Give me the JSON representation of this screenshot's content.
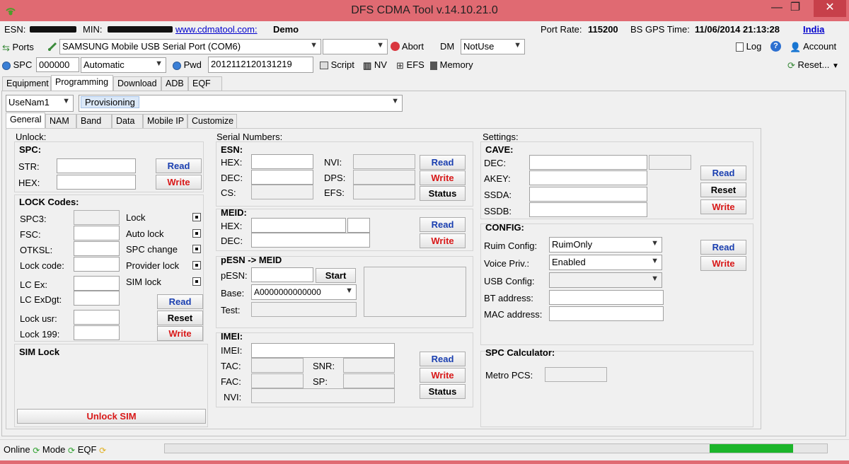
{
  "window": {
    "title": "DFS CDMA Tool v.14.10.21.0",
    "min": "—",
    "max": "❐",
    "close": "✕"
  },
  "info": {
    "esn_label": "ESN:",
    "min_label": "MIN:",
    "site": "www.cdmatool.com:",
    "mode": "Demo",
    "port_rate_label": "Port Rate:",
    "port_rate": "115200",
    "gps_label": "BS GPS Time:",
    "gps_time": "11/06/2014 21:13:28",
    "country": "India"
  },
  "toolbar1": {
    "ports": "Ports",
    "port_value": "SAMSUNG Mobile USB Serial Port  (COM6)",
    "abort": "Abort",
    "dm": "DM",
    "dm_value": "NotUse",
    "log": "Log",
    "account": "Account"
  },
  "toolbar2": {
    "spc": "SPC",
    "spc_value": "000000",
    "mode_value": "Automatic",
    "pwd": "Pwd",
    "pwd_value": "2012112120131219",
    "script": "Script",
    "nv": "NV",
    "efs": "EFS",
    "memory": "Memory",
    "reset": "Reset..."
  },
  "main_tabs": [
    "Equipment",
    "Programming",
    "Download",
    "ADB",
    "EQF"
  ],
  "user_combo": "UseNam1",
  "provisioning": "Provisioning",
  "sub_tabs": [
    "General",
    "NAM",
    "Band",
    "Data",
    "Mobile IP",
    "Customize"
  ],
  "unlock": {
    "title": "Unlock:",
    "spc_title": "SPC:",
    "str": "STR:",
    "hex": "HEX:",
    "read": "Read",
    "write": "Write",
    "lock_title": "LOCK Codes:",
    "spc3": "SPC3:",
    "fsc": "FSC:",
    "otksl": "OTKSL:",
    "lock_code": "Lock code:",
    "lc_ex": "LC Ex:",
    "lc_exdgt": "LC ExDgt:",
    "lock_usr": "Lock usr:",
    "lock_199": "Lock 199:",
    "lock": "Lock",
    "auto_lock": "Auto lock",
    "spc_change": "SPC change",
    "provider_lock": "Provider lock",
    "sim_lock": "SIM lock",
    "reset": "Reset",
    "sim_lock_title": "SIM Lock",
    "unlock_sim": "Unlock SIM"
  },
  "serial": {
    "title": "Serial Numbers:",
    "esn_title": "ESN:",
    "hex": "HEX:",
    "dec": "DEC:",
    "cs": "CS:",
    "nvi": "NVI:",
    "dps": "DPS:",
    "efs": "EFS:",
    "read": "Read",
    "write": "Write",
    "status": "Status",
    "meid_title": "MEID:",
    "pesn_title": "pESN -> MEID",
    "pesn": "pESN:",
    "start": "Start",
    "base": "Base:",
    "base_value": "A0000000000000",
    "test": "Test:",
    "imei_title": "IMEI:",
    "imei": "IMEI:",
    "tac": "TAC:",
    "fac": "FAC:",
    "nvi2": "NVI:",
    "snr": "SNR:",
    "sp": "SP:"
  },
  "settings": {
    "title": "Settings:",
    "cave_title": "CAVE:",
    "dec": "DEC:",
    "akey": "AKEY:",
    "ssda": "SSDA:",
    "ssdb": "SSDB:",
    "read": "Read",
    "reset": "Reset",
    "write": "Write",
    "config_title": "CONFIG:",
    "ruim": "Ruim Config:",
    "ruim_value": "RuimOnly",
    "voice": "Voice Priv.:",
    "voice_value": "Enabled",
    "usb": "USB Config:",
    "bt": "BT address:",
    "mac": "MAC address:",
    "calc_title": "SPC Calculator:",
    "metro": "Metro PCS:"
  },
  "status": {
    "online": "Online",
    "mode": "Mode",
    "eqf": "EQF",
    "progress": 0.12
  },
  "colors": {
    "titlebar": "#e06a72",
    "close": "#c7404a",
    "progress": "#1cb52a",
    "read": "#1a3fb0",
    "write": "#d81818"
  }
}
